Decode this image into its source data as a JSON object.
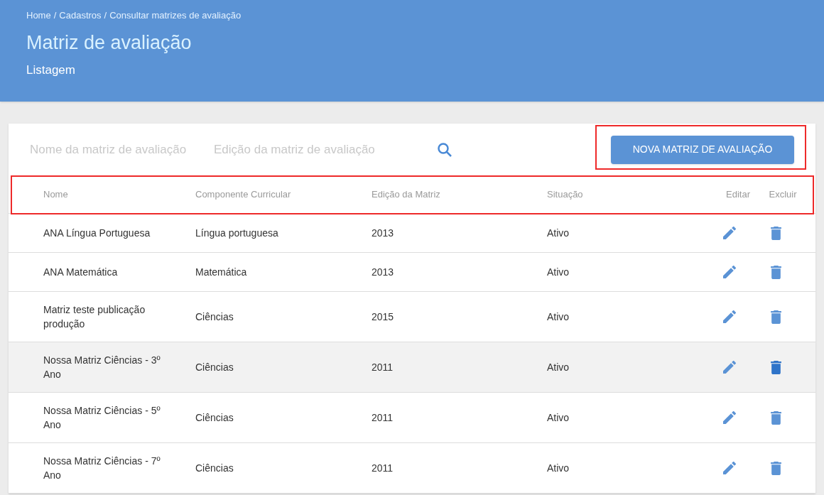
{
  "breadcrumb": [
    "Home",
    "Cadastros",
    "Consultar matrizes de avaliação"
  ],
  "breadcrumb_separator": "/",
  "page_title": "Matriz de avaliação",
  "page_subtitle": "Listagem",
  "filters": [
    {
      "placeholder": "Nome da matriz de avaliação"
    },
    {
      "placeholder": "Edição da matriz de avaliação"
    }
  ],
  "new_button": {
    "label": "NOVA MATRIZ DE AVALIAÇÃO",
    "highlighted": true
  },
  "table": {
    "highlighted": true,
    "columns": [
      "Nome",
      "Componente Curricular",
      "Edição da Matriz",
      "Situação",
      "Editar",
      "Excluir"
    ],
    "rows": [
      {
        "name": "ANA Língua Portuguesa",
        "component": "Língua portuguesa",
        "edition": "2013",
        "status": "Ativo",
        "hovered": false
      },
      {
        "name": "ANA Matemática",
        "component": "Matemática",
        "edition": "2013",
        "status": "Ativo",
        "hovered": false
      },
      {
        "name": "Matriz teste publicação produção",
        "component": "Ciências",
        "edition": "2015",
        "status": "Ativo",
        "hovered": false
      },
      {
        "name": "Nossa Matriz Ciências - 3º Ano",
        "component": "Ciências",
        "edition": "2011",
        "status": "Ativo",
        "hovered": true
      },
      {
        "name": "Nossa Matriz Ciências - 5º Ano",
        "component": "Ciências",
        "edition": "2011",
        "status": "Ativo",
        "hovered": false
      },
      {
        "name": "Nossa Matriz Ciências - 7º Ano",
        "component": "Ciências",
        "edition": "2011",
        "status": "Ativo",
        "hovered": false
      }
    ]
  }
}
